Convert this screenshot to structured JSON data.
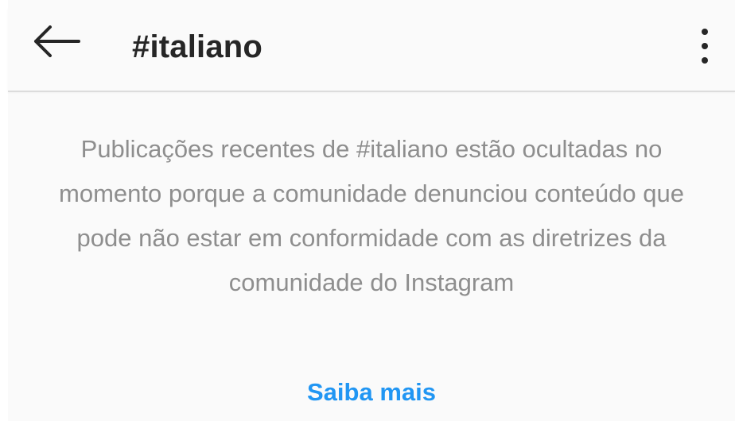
{
  "header": {
    "back_icon": "arrow-left-icon",
    "title": "#italiano",
    "more_icon": "vertical-ellipsis-icon"
  },
  "notice": {
    "message": "Publicações recentes de #italiano estão ocultadas no momento porque a comunidade denunciou conteúdo que pode não estar em conformidade com as diretrizes da comunidade do Instagram"
  },
  "link": {
    "label": "Saiba mais"
  },
  "colors": {
    "background": "#fafafa",
    "title": "#262626",
    "message": "#8e8e8e",
    "link": "#2196f3"
  }
}
